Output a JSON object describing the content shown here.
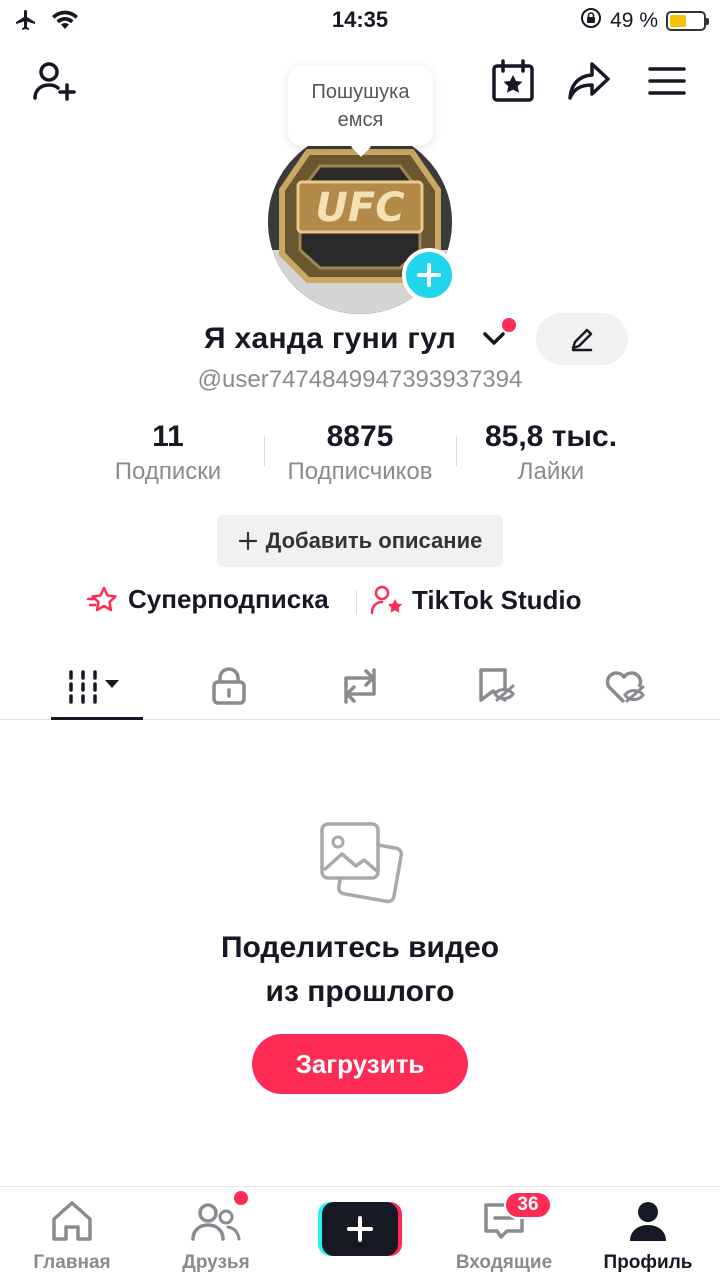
{
  "status_bar": {
    "time": "14:35",
    "battery_percent": "49 %",
    "battery_level": 0.49,
    "icons": [
      "airplane-icon",
      "wifi-icon",
      "orientation-lock-icon",
      "battery-icon"
    ]
  },
  "header": {
    "tooltip": "Пошушука емся",
    "icons": [
      "add-friend-icon",
      "calendar-star-icon",
      "share-icon",
      "menu-icon"
    ]
  },
  "profile": {
    "display_name": "Я ханда гуни гул",
    "username": "@user7474849947393937394",
    "avatar_text": "UFC",
    "stats": [
      {
        "value": "11",
        "label": "Подписки"
      },
      {
        "value": "8875",
        "label": "Подписчиков"
      },
      {
        "value": "85,8 тыс.",
        "label": "Лайки"
      }
    ],
    "add_description": "Добавить описание",
    "links": [
      {
        "label": "Суперподписка",
        "icon": "super-follow-icon"
      },
      {
        "label": "TikTok Studio",
        "icon": "tiktok-studio-icon"
      }
    ]
  },
  "tabs": [
    "videos-grid-icon",
    "private-lock-icon",
    "reposts-icon",
    "favorites-bookmark-icon",
    "liked-heart-icon"
  ],
  "empty_state": {
    "title_line1": "Поделитесь видео",
    "title_line2": "из прошлого",
    "button": "Загрузить"
  },
  "bottom_nav": {
    "items": [
      {
        "label": "Главная",
        "icon": "home-icon"
      },
      {
        "label": "Друзья",
        "icon": "friends-icon"
      },
      {
        "label": "",
        "icon": "create-plus-icon"
      },
      {
        "label": "Входящие",
        "icon": "inbox-icon",
        "badge": "36"
      },
      {
        "label": "Профиль",
        "icon": "profile-icon"
      }
    ]
  },
  "colors": {
    "accent": "#fe2c55",
    "cyan": "#20d5ec",
    "text": "#161823",
    "muted": "#8a8b91"
  }
}
